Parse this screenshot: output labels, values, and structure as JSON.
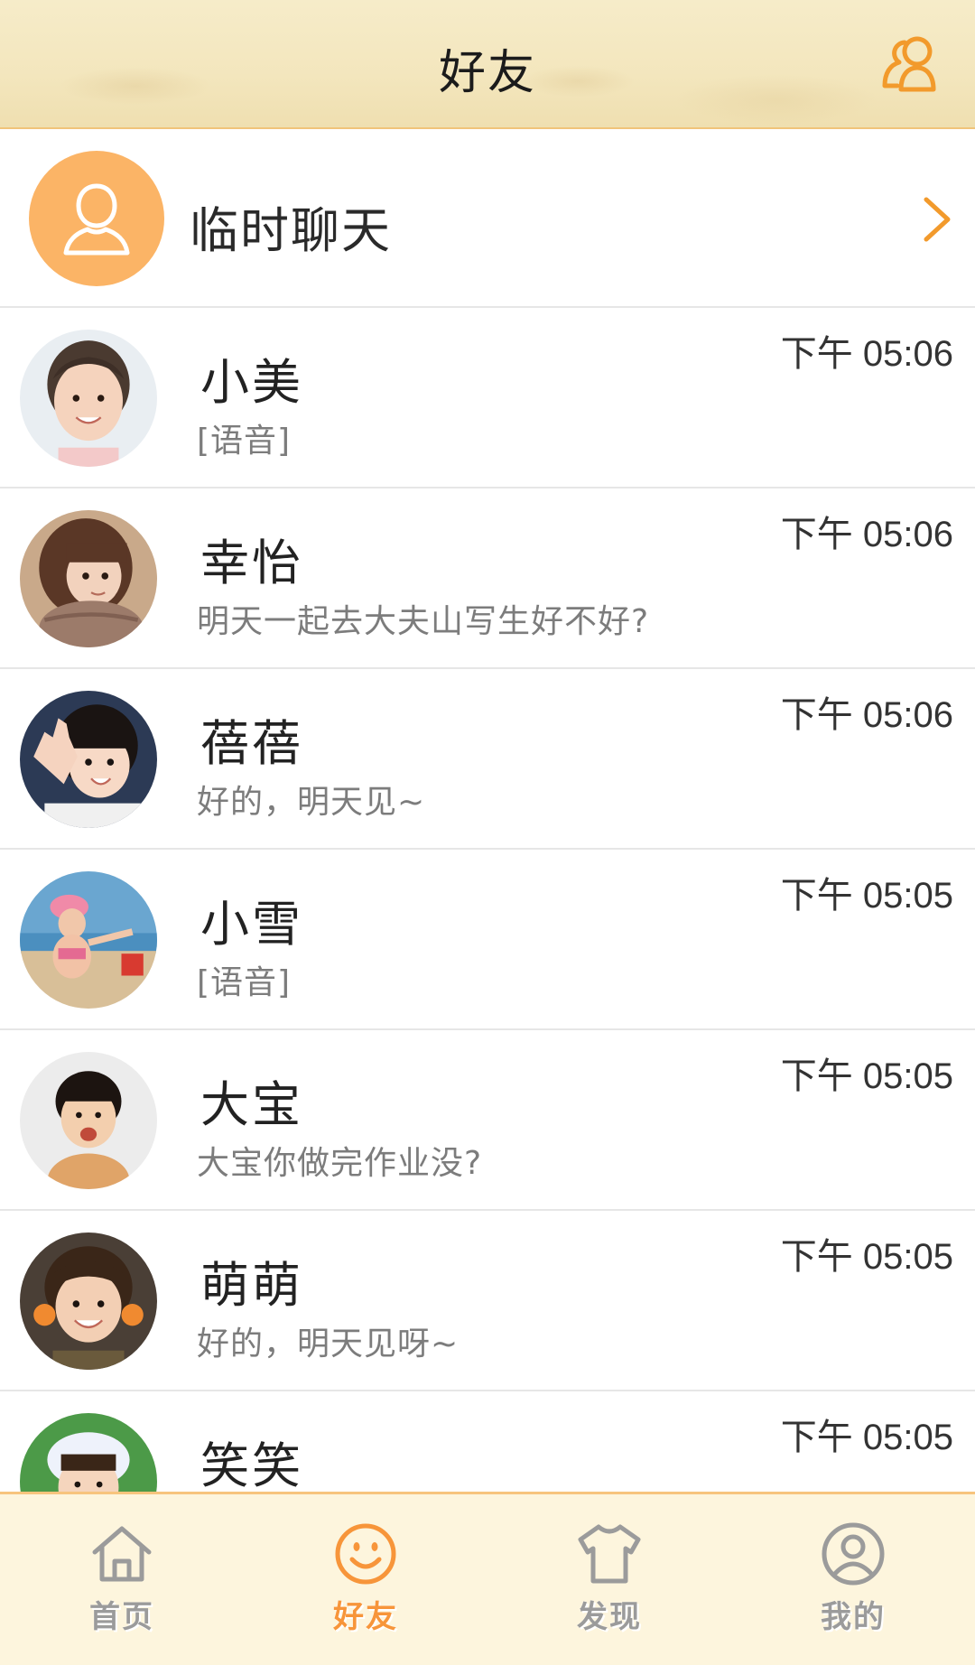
{
  "header": {
    "title": "好友",
    "contacts_icon": "contacts-icon"
  },
  "temp_chat": {
    "label": "临时聊天",
    "avatar_icon": "person-icon",
    "chevron_icon": "chevron-right-icon"
  },
  "chats": [
    {
      "name": "小美",
      "message": "[语音]",
      "time": "下午 05:06"
    },
    {
      "name": "幸怡",
      "message": "明天一起去大夫山写生好不好?",
      "time": "下午 05:06"
    },
    {
      "name": "蓓蓓",
      "message": "好的，明天见~",
      "time": "下午 05:06"
    },
    {
      "name": "小雪",
      "message": "[语音]",
      "time": "下午 05:05"
    },
    {
      "name": "大宝",
      "message": "大宝你做完作业没?",
      "time": "下午 05:05"
    },
    {
      "name": "萌萌",
      "message": "好的，明天见呀~",
      "time": "下午 05:05"
    },
    {
      "name": "笑笑",
      "message": "",
      "time": "下午 05:05"
    }
  ],
  "tabbar": {
    "tabs": [
      {
        "label": "首页",
        "icon": "home-icon",
        "active": false
      },
      {
        "label": "好友",
        "icon": "smiley-icon",
        "active": true
      },
      {
        "label": "发现",
        "icon": "tshirt-icon",
        "active": false
      },
      {
        "label": "我的",
        "icon": "user-circle-icon",
        "active": false
      }
    ]
  },
  "colors": {
    "accent": "#f7953a",
    "header_bg": "#f4e8c2",
    "tab_bg": "#fdf5dd",
    "temp_avatar_bg": "#fbb466"
  }
}
